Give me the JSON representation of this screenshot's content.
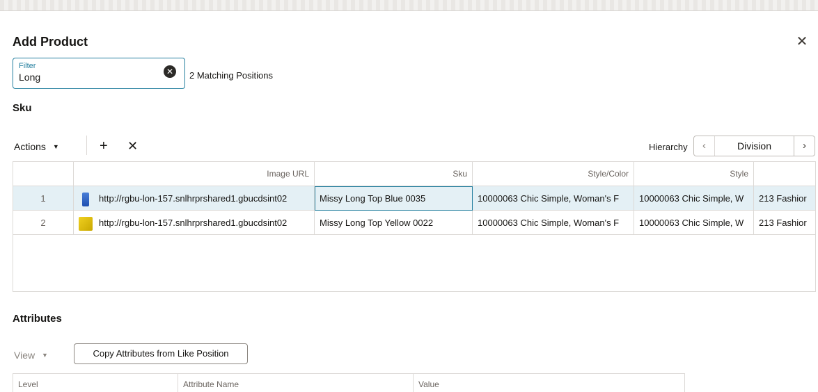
{
  "dialog": {
    "title": "Add Product",
    "close_icon": "close-icon"
  },
  "filter": {
    "label": "Filter",
    "value": "Long",
    "clear_icon": "clear-circle-icon",
    "match_text": "2 Matching Positions"
  },
  "sku_section": {
    "title": "Sku",
    "toolbar": {
      "actions_label": "Actions",
      "add_icon": "plus-icon",
      "remove_icon": "close-icon"
    },
    "hierarchy": {
      "label": "Hierarchy",
      "value": "Division",
      "prev_icon": "chevron-left-icon",
      "next_icon": "chevron-right-icon"
    },
    "columns": [
      "",
      "Image URL",
      "Sku",
      "Style/Color",
      "Style",
      ""
    ],
    "rows": [
      {
        "num": "1",
        "image_url": "http://rgbu-lon-157.snlhrprshared1.gbucdsint02",
        "thumb_color": "#2f5fc8",
        "sku": "Missy Long Top Blue 0035",
        "style_color": "10000063 Chic Simple, Woman's F",
        "style": "10000063 Chic Simple, W",
        "extra": "213 Fashior"
      },
      {
        "num": "2",
        "image_url": "http://rgbu-lon-157.snlhrprshared1.gbucdsint02",
        "thumb_color": "#e0c010",
        "sku": "Missy Long Top Yellow 0022",
        "style_color": "10000063 Chic Simple, Woman's F",
        "style": "10000063 Chic Simple, W",
        "extra": "213 Fashior"
      }
    ]
  },
  "attributes_section": {
    "title": "Attributes",
    "view_label": "View",
    "copy_button": "Copy Attributes from Like Position",
    "columns": [
      "Level",
      "Attribute Name",
      "Value"
    ]
  },
  "colors": {
    "accent": "#227e9e",
    "selected_row": "#e4f0f5"
  }
}
